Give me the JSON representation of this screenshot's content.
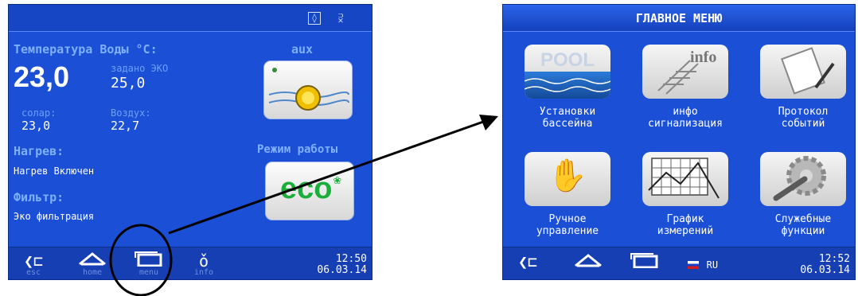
{
  "left": {
    "water_temp_label": "Температура Воды  °C:",
    "water_temp": "23,0",
    "set_label": "задано ЭКО",
    "set_value": "25,0",
    "solar_label": "солар:",
    "solar_value": "23,0",
    "air_label": "Воздух:",
    "air_value": "22,7",
    "heating_label": "Нагрев:",
    "heating_value": "Нагрев Включен",
    "filter_label": "Фильтр:",
    "filter_value": "Эко фильтрация",
    "aux_label": "aux",
    "mode_label": "Режим работы",
    "eco_text": "eco",
    "nav": {
      "esc": "esc",
      "home": "home",
      "menu": "menu",
      "info": "info"
    },
    "time": "12:50",
    "date": "06.03.14"
  },
  "right": {
    "title": "ГЛАВНОЕ МЕНЮ",
    "tiles": [
      {
        "l1": "Установки",
        "l2": "бассейна",
        "img": "POOL"
      },
      {
        "l1": "инфо",
        "l2": "сигнализация",
        "img": "info"
      },
      {
        "l1": "Протокол",
        "l2": "событий",
        "img": ""
      },
      {
        "l1": "Ручное",
        "l2": "управление",
        "img": ""
      },
      {
        "l1": "График",
        "l2": "измерений",
        "img": ""
      },
      {
        "l1": "Служебные",
        "l2": "функции",
        "img": ""
      }
    ],
    "lang": "RU",
    "time": "12:52",
    "date": "06.03.14"
  },
  "colors": {
    "screen_bg": "#1a4fd6",
    "label": "#7fb0ff",
    "arrow": "#000000"
  }
}
